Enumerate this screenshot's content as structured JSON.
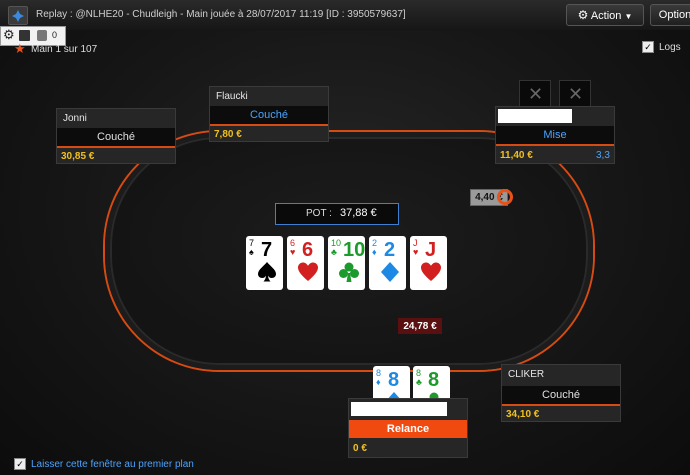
{
  "window": {
    "title": "Replay : @NLHE20 - Chudleigh - Main jouée à  28/07/2017 11:19 [ID : 3950579637]",
    "action_label": "Action",
    "option_label": "Option"
  },
  "toolbar": {
    "counter": "0"
  },
  "hand_info": "Main 1 sur 107",
  "logs_label": "Logs",
  "pot": {
    "label": "POT :",
    "value": "37,88 €"
  },
  "board": [
    {
      "rank": "7",
      "suit": "spade",
      "color": "#000000"
    },
    {
      "rank": "6",
      "suit": "heart",
      "color": "#d21f1f"
    },
    {
      "rank": "10",
      "suit": "club",
      "color": "#1c9a2c"
    },
    {
      "rank": "2",
      "suit": "diamond",
      "color": "#1e88e5"
    },
    {
      "rank": "J",
      "suit": "heart",
      "color": "#d21f1f"
    }
  ],
  "hero_cards": [
    {
      "rank": "8",
      "suit": "diamond",
      "color": "#1e88e5"
    },
    {
      "rank": "8",
      "suit": "club",
      "color": "#1c9a2c"
    }
  ],
  "players": {
    "jonni": {
      "name": "Jonni",
      "action": "Couché",
      "stack": "30,85 €"
    },
    "flaucki": {
      "name": "Flaucki",
      "action": "Couché",
      "stack": "7,80 €"
    },
    "right": {
      "name": "",
      "action": "Mise",
      "stack": "11,40 €",
      "extra": "3,3"
    },
    "hero": {
      "name": "",
      "action": "Relance",
      "stack": "0 €"
    },
    "cliker": {
      "name": "CLIKER",
      "action": "Couché",
      "stack": "34,10 €"
    }
  },
  "bets": {
    "right_bet": "4,40 €",
    "hero_bet": "24,78 €"
  },
  "footer": {
    "always_on_top": "Laisser cette fenêtre au premier plan"
  },
  "colors": {
    "accent": "#d64b12",
    "stack": "#f0c020",
    "mise": "#4aa3ff"
  }
}
